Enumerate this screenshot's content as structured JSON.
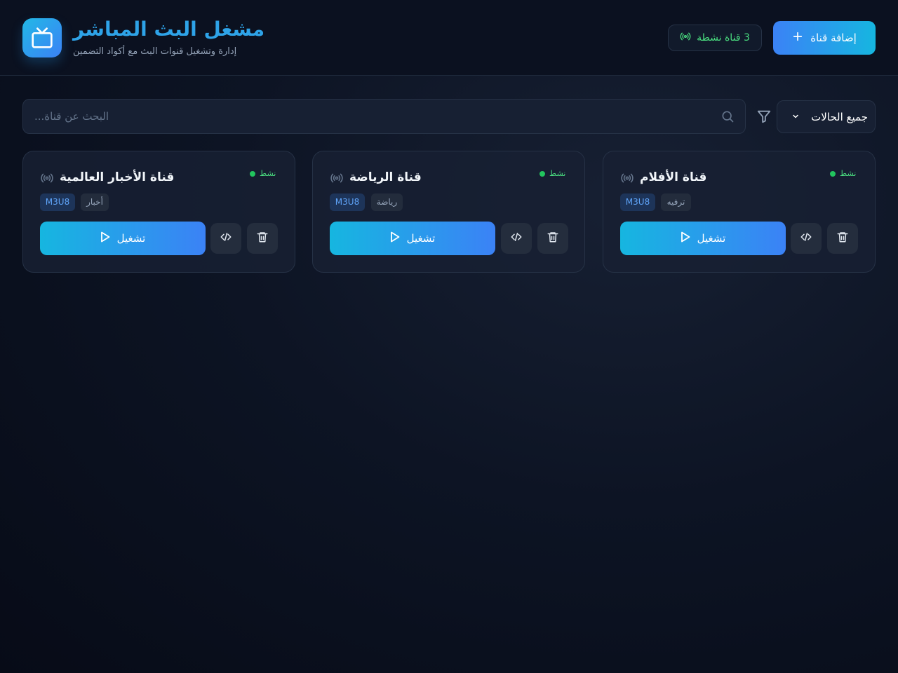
{
  "header": {
    "title": "مشغل البث المباشر",
    "subtitle": "إدارة وتشغيل قنوات البث مع أكواد التضمين",
    "active_count_label": "3 قناة نشطة",
    "add_button_label": "إضافة قناة"
  },
  "toolbar": {
    "search_placeholder": "البحث عن قناة...",
    "status_filter_value": "جميع الحالات"
  },
  "channels": [
    {
      "name": "قناة الأفلام",
      "status": "نشط",
      "category": "ترفيه",
      "type": "M3U8",
      "play_label": "تشغيل"
    },
    {
      "name": "قناة الرياضة",
      "status": "نشط",
      "category": "رياضة",
      "type": "M3U8",
      "play_label": "تشغيل"
    },
    {
      "name": "قناة الأخبار العالمية",
      "status": "نشط",
      "category": "أخبار",
      "type": "M3U8",
      "play_label": "تشغيل"
    }
  ],
  "colors": {
    "accent_start": "#16b6e0",
    "accent_end": "#3b82f6",
    "status_active": "#22c55e",
    "background": "#0d1424"
  }
}
